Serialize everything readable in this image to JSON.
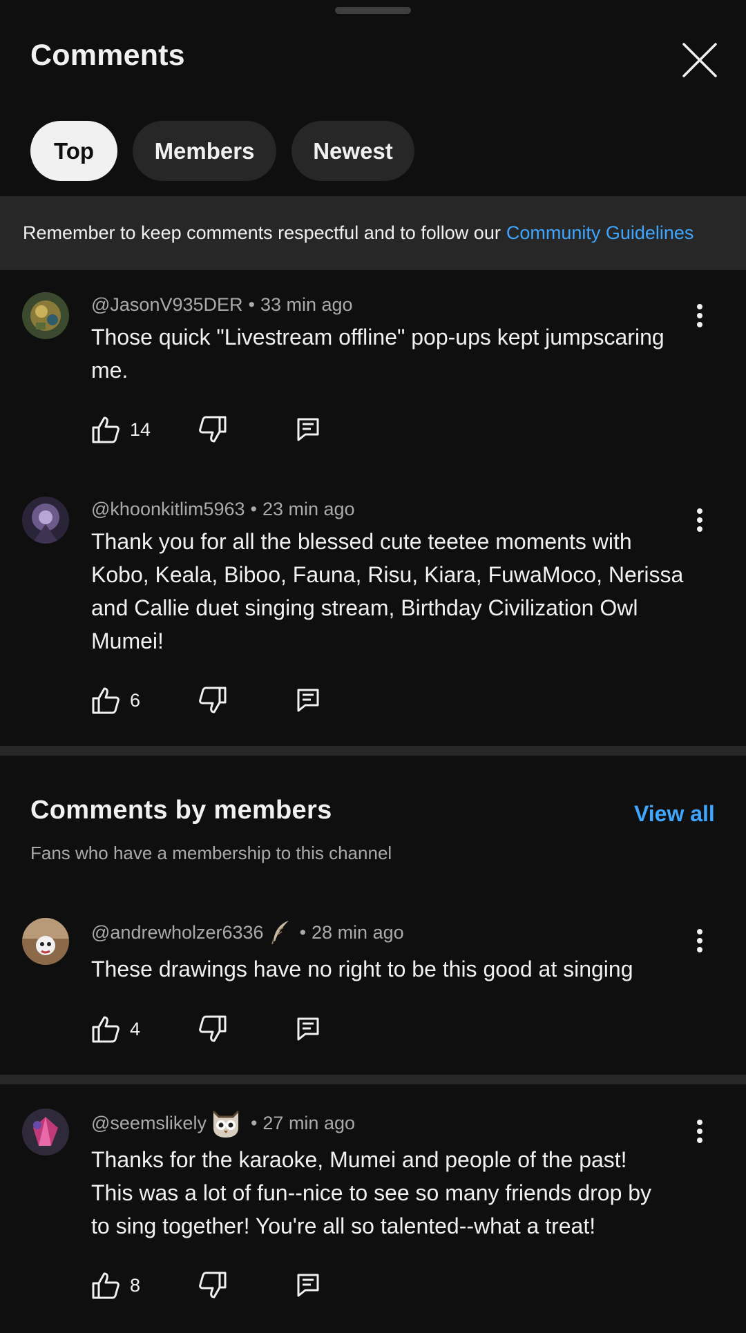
{
  "header": {
    "title": "Comments",
    "close_icon": "close-icon"
  },
  "tabs": [
    {
      "label": "Top",
      "selected": true
    },
    {
      "label": "Members",
      "selected": false
    },
    {
      "label": "Newest",
      "selected": false
    }
  ],
  "notice": {
    "text": "Remember to keep comments respectful and to follow our",
    "link": "Community Guidelines"
  },
  "comments": [
    {
      "handle": "@JasonV935DER",
      "time": "33 min ago",
      "lines": [
        "Those quick \"Livestream offline\" pop-ups kept jumpscaring",
        "me."
      ],
      "likes": "14"
    },
    {
      "handle": "@khoonkitlim5963",
      "time": "23 min ago",
      "lines": [
        "Thank you for all the blessed cute teetee moments with",
        "Kobo, Keala, Biboo, Fauna, Risu, Kiara, FuwaMoco, Nerissa",
        "and Callie duet singing stream, Birthday Civilization Owl",
        "Mumei!"
      ],
      "likes": "6"
    }
  ],
  "members_section": {
    "title": "Comments by members",
    "subtitle": "Fans who have a membership to this channel",
    "view_all": "View all"
  },
  "member_comments": [
    {
      "handle": "@andrewholzer6336",
      "time": "28 min ago",
      "badge": "feather-badge-icon",
      "lines": [
        "These drawings have no right to be this good at singing"
      ],
      "likes": "4"
    },
    {
      "handle": "@seemslikely",
      "time": "27 min ago",
      "badge": "owl-badge-icon",
      "lines": [
        "Thanks for the karaoke, Mumei and people of the past!",
        "This was a lot of fun--nice to see so many friends drop by",
        "to sing together! You're all so talented--what a treat!"
      ],
      "likes": "8"
    }
  ],
  "separator": "•",
  "colors": {
    "background": "#0f0f0f",
    "surface": "#272727",
    "link": "#3ea6ff",
    "text": "#f1f1f1",
    "secondary_text": "#aaaaaa"
  }
}
